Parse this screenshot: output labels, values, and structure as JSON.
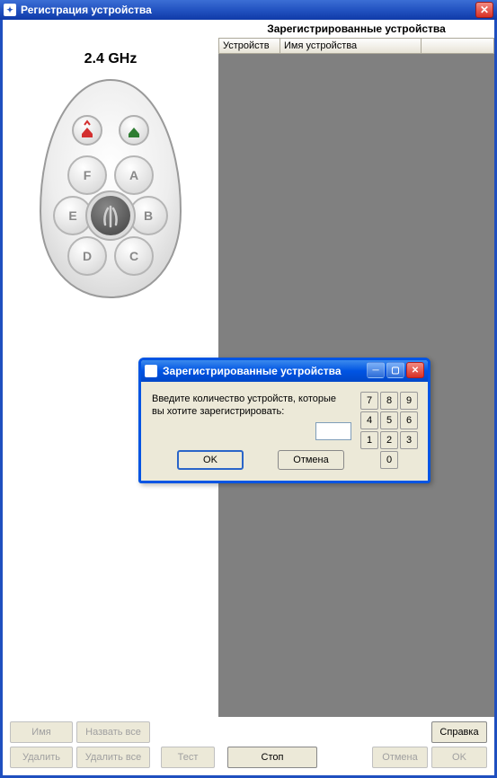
{
  "main_window": {
    "title": "Регистрация устройства",
    "frequency_label": "2.4 GHz"
  },
  "remote": {
    "red_icon": "house-up-icon",
    "green_icon": "house-check-icon",
    "buttons": [
      "F",
      "A",
      "E",
      "B",
      "D",
      "C"
    ]
  },
  "table": {
    "title": "Зарегистрированные устройства",
    "columns": {
      "c1": "Устройств",
      "c2": "Имя устройства",
      "c3": ""
    }
  },
  "bottom": {
    "name": "Имя",
    "name_all": "Назвать все",
    "help": "Справка",
    "delete": "Удалить",
    "delete_all": "Удалить все",
    "test": "Тест",
    "stop": "Стоп",
    "cancel": "Отмена",
    "ok": "OK"
  },
  "dialog": {
    "title": "Зарегистрированные устройства",
    "prompt": "Введите количество устройств, которые вы хотите зарегистрировать:",
    "input_value": "",
    "ok": "OK",
    "cancel": "Отмена",
    "keypad": {
      "r1": [
        "7",
        "8",
        "9"
      ],
      "r2": [
        "4",
        "5",
        "6"
      ],
      "r3": [
        "1",
        "2",
        "3"
      ],
      "r4": [
        "0"
      ]
    }
  }
}
